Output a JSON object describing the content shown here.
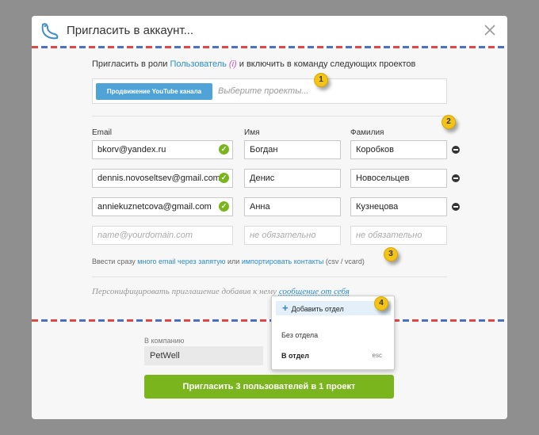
{
  "modal": {
    "title": "Пригласить в аккаунт...",
    "icons": {
      "logo": "bird-logo-icon",
      "close": "close-icon"
    }
  },
  "role_line": {
    "prefix": "Пригласить в роли ",
    "role": "Пользователь",
    "tip": " (i) ",
    "suffix": "и включить в команду следующих проектов"
  },
  "projects": {
    "selected_tag": "Продвижение YouTube канала",
    "placeholder": "Выберите проекты..."
  },
  "columns": {
    "email": "Email",
    "first_name": "Имя",
    "last_name": "Фамилия"
  },
  "invitees": [
    {
      "email": "bkorv@yandex.ru",
      "first_name": "Богдан",
      "last_name": "Коробков"
    },
    {
      "email": "dennis.novoseltsev@gmail.com",
      "first_name": "Денис",
      "last_name": "Новосельцев"
    },
    {
      "email": "anniekuznetcova@gmail.com",
      "first_name": "Анна",
      "last_name": "Кузнецова"
    }
  ],
  "empty_row": {
    "email_placeholder": "name@yourdomain.com",
    "first_name_placeholder": "не обязательно",
    "last_name_placeholder": "не обязательно"
  },
  "bulk_line": {
    "prefix": "Ввести сразу ",
    "many_link": "много email через запятую",
    "middle": " или ",
    "import_link": "импортировать контакты",
    "suffix": " (csv / vcard)"
  },
  "personal": {
    "prefix": "Персонифицировать приглашение добавив к нему ",
    "link": "сообщение от себя"
  },
  "company": {
    "label": "В компанию",
    "value": "PetWell"
  },
  "submit_label": "Пригласить 3 пользователей в 1 проект",
  "dropdown": {
    "add_label": "Добавить отдел",
    "no_department": "Без отдела",
    "to_department": "В отдел",
    "esc_hint": "esc"
  },
  "badges": [
    "1",
    "2",
    "3",
    "4"
  ],
  "colors": {
    "accent_green": "#7ab51d",
    "link_blue": "#2e8cc5",
    "tag_blue": "#4fa3d6",
    "badge_yellow": "#f3c318"
  }
}
